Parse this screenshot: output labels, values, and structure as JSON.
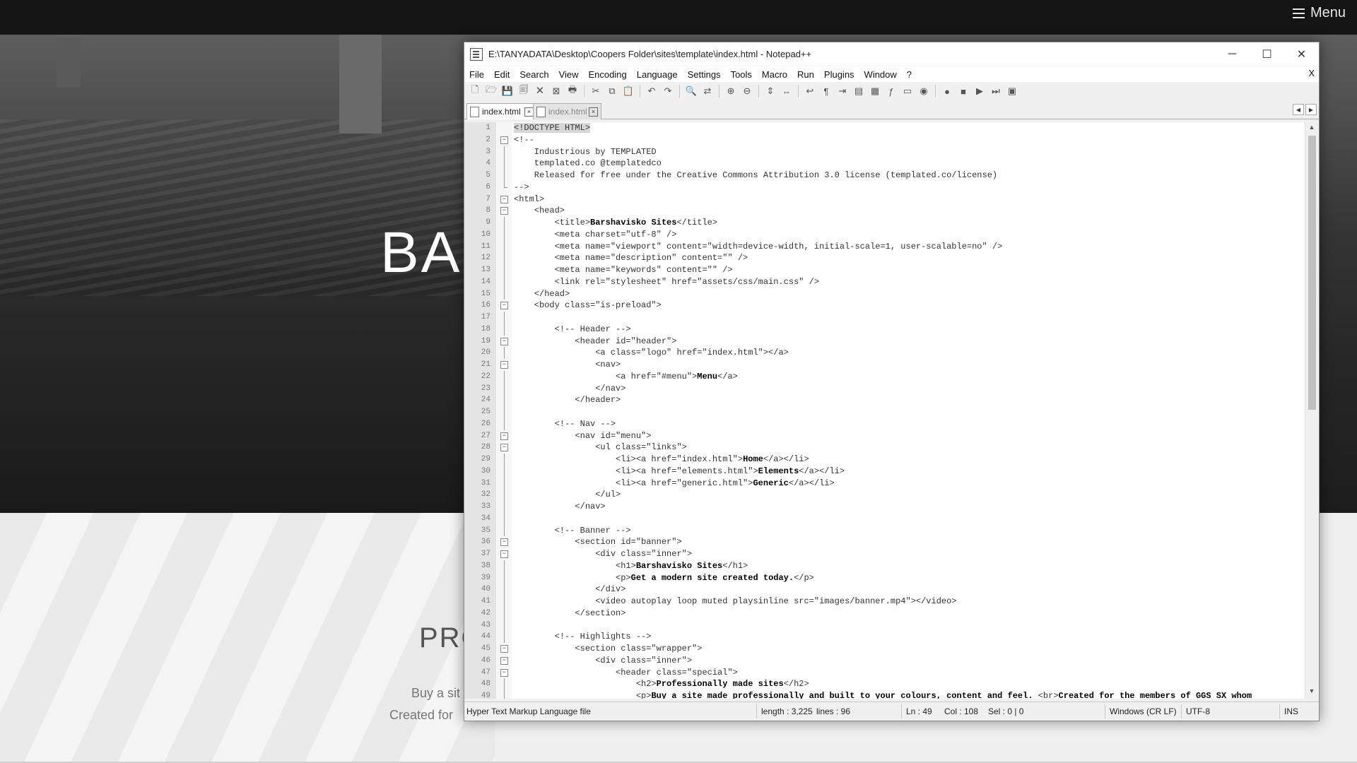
{
  "website": {
    "menu_label": "Menu",
    "banner_title": "BAR",
    "section_heading": "PRO",
    "text_line1": "Buy a sit",
    "text_line2": "Created for"
  },
  "window": {
    "title": "E:\\TANYADATA\\Desktop\\Coopers Folder\\sites\\template\\index.html - Notepad++",
    "minimize": "─",
    "maximize": "☐",
    "close": "✕"
  },
  "menu": {
    "items": [
      "File",
      "Edit",
      "Search",
      "View",
      "Encoding",
      "Language",
      "Settings",
      "Tools",
      "Macro",
      "Run",
      "Plugins",
      "Window",
      "?"
    ],
    "close": "X"
  },
  "toolbar_icons": [
    "new-file-icon",
    "open-file-icon",
    "save-icon",
    "save-all-icon",
    "close-icon",
    "close-all-icon",
    "print-icon",
    "sep",
    "cut-icon",
    "copy-icon",
    "paste-icon",
    "sep",
    "undo-icon",
    "redo-icon",
    "sep",
    "find-icon",
    "replace-icon",
    "sep",
    "zoom-in-icon",
    "zoom-out-icon",
    "sep",
    "sync-vertical-icon",
    "sync-horizontal-icon",
    "sep",
    "word-wrap-icon",
    "show-all-chars-icon",
    "indent-guide-icon",
    "user-lang-icon",
    "doc-map-icon",
    "function-list-icon",
    "folder-workspace-icon",
    "monitor-icon",
    "sep",
    "record-macro-icon",
    "stop-macro-icon",
    "play-macro-icon",
    "run-macro-multiple-icon",
    "save-macro-icon"
  ],
  "tabs": [
    {
      "label": "index.html",
      "active": true
    },
    {
      "label": "index.html",
      "active": false
    }
  ],
  "editor": {
    "lines": [
      "<!DOCTYPE HTML>",
      "<!--",
      "    Industrious by TEMPLATED",
      "    templated.co @templatedco",
      "    Released for free under the Creative Commons Attribution 3.0 license (templated.co/license)",
      "-->",
      "<html>",
      "    <head>",
      "        <title>Barshavisko Sites</title>",
      "        <meta charset=\"utf-8\" />",
      "        <meta name=\"viewport\" content=\"width=device-width, initial-scale=1, user-scalable=no\" />",
      "        <meta name=\"description\" content=\"\" />",
      "        <meta name=\"keywords\" content=\"\" />",
      "        <link rel=\"stylesheet\" href=\"assets/css/main.css\" />",
      "    </head>",
      "    <body class=\"is-preload\">",
      "",
      "        <!-- Header -->",
      "            <header id=\"header\">",
      "                <a class=\"logo\" href=\"index.html\"></a>",
      "                <nav>",
      "                    <a href=\"#menu\">Menu</a>",
      "                </nav>",
      "            </header>",
      "",
      "        <!-- Nav -->",
      "            <nav id=\"menu\">",
      "                <ul class=\"links\">",
      "                    <li><a href=\"index.html\">Home</a></li>",
      "                    <li><a href=\"elements.html\">Elements</a></li>",
      "                    <li><a href=\"generic.html\">Generic</a></li>",
      "                </ul>",
      "            </nav>",
      "",
      "        <!-- Banner -->",
      "            <section id=\"banner\">",
      "                <div class=\"inner\">",
      "                    <h1>Barshavisko Sites</h1>",
      "                    <p>Get a modern site created today.</p>",
      "                </div>",
      "                <video autoplay loop muted playsinline src=\"images/banner.mp4\"></video>",
      "            </section>",
      "",
      "        <!-- Highlights -->",
      "            <section class=\"wrapper\">",
      "                <div class=\"inner\">",
      "                    <header class=\"special\">",
      "                        <h2>Professionally made sites</h2>",
      "                        <p>Buy a site made professionally and built to your colours, content and feel. <br>Created for the members of GGS SX whom"
    ],
    "folds": [
      "",
      "open",
      "v",
      "v",
      "v",
      "end",
      "open",
      "open",
      "v",
      "v",
      "v",
      "v",
      "v",
      "v",
      "v",
      "open",
      "v",
      "v",
      "open",
      "v",
      "open",
      "v",
      "v",
      "v",
      "v",
      "v",
      "open",
      "open",
      "v",
      "v",
      "v",
      "v",
      "v",
      "v",
      "v",
      "open",
      "open",
      "v",
      "v",
      "v",
      "v",
      "v",
      "v",
      "v",
      "open",
      "open",
      "open",
      "v",
      "v"
    ]
  },
  "status": {
    "file_type": "Hyper Text Markup Language file",
    "length": "length : 3,225",
    "lines": "lines : 96",
    "ln": "Ln : 49",
    "col": "Col : 108",
    "sel": "Sel : 0 | 0",
    "eol": "Windows (CR LF)",
    "encoding": "UTF-8",
    "mode": "INS"
  }
}
